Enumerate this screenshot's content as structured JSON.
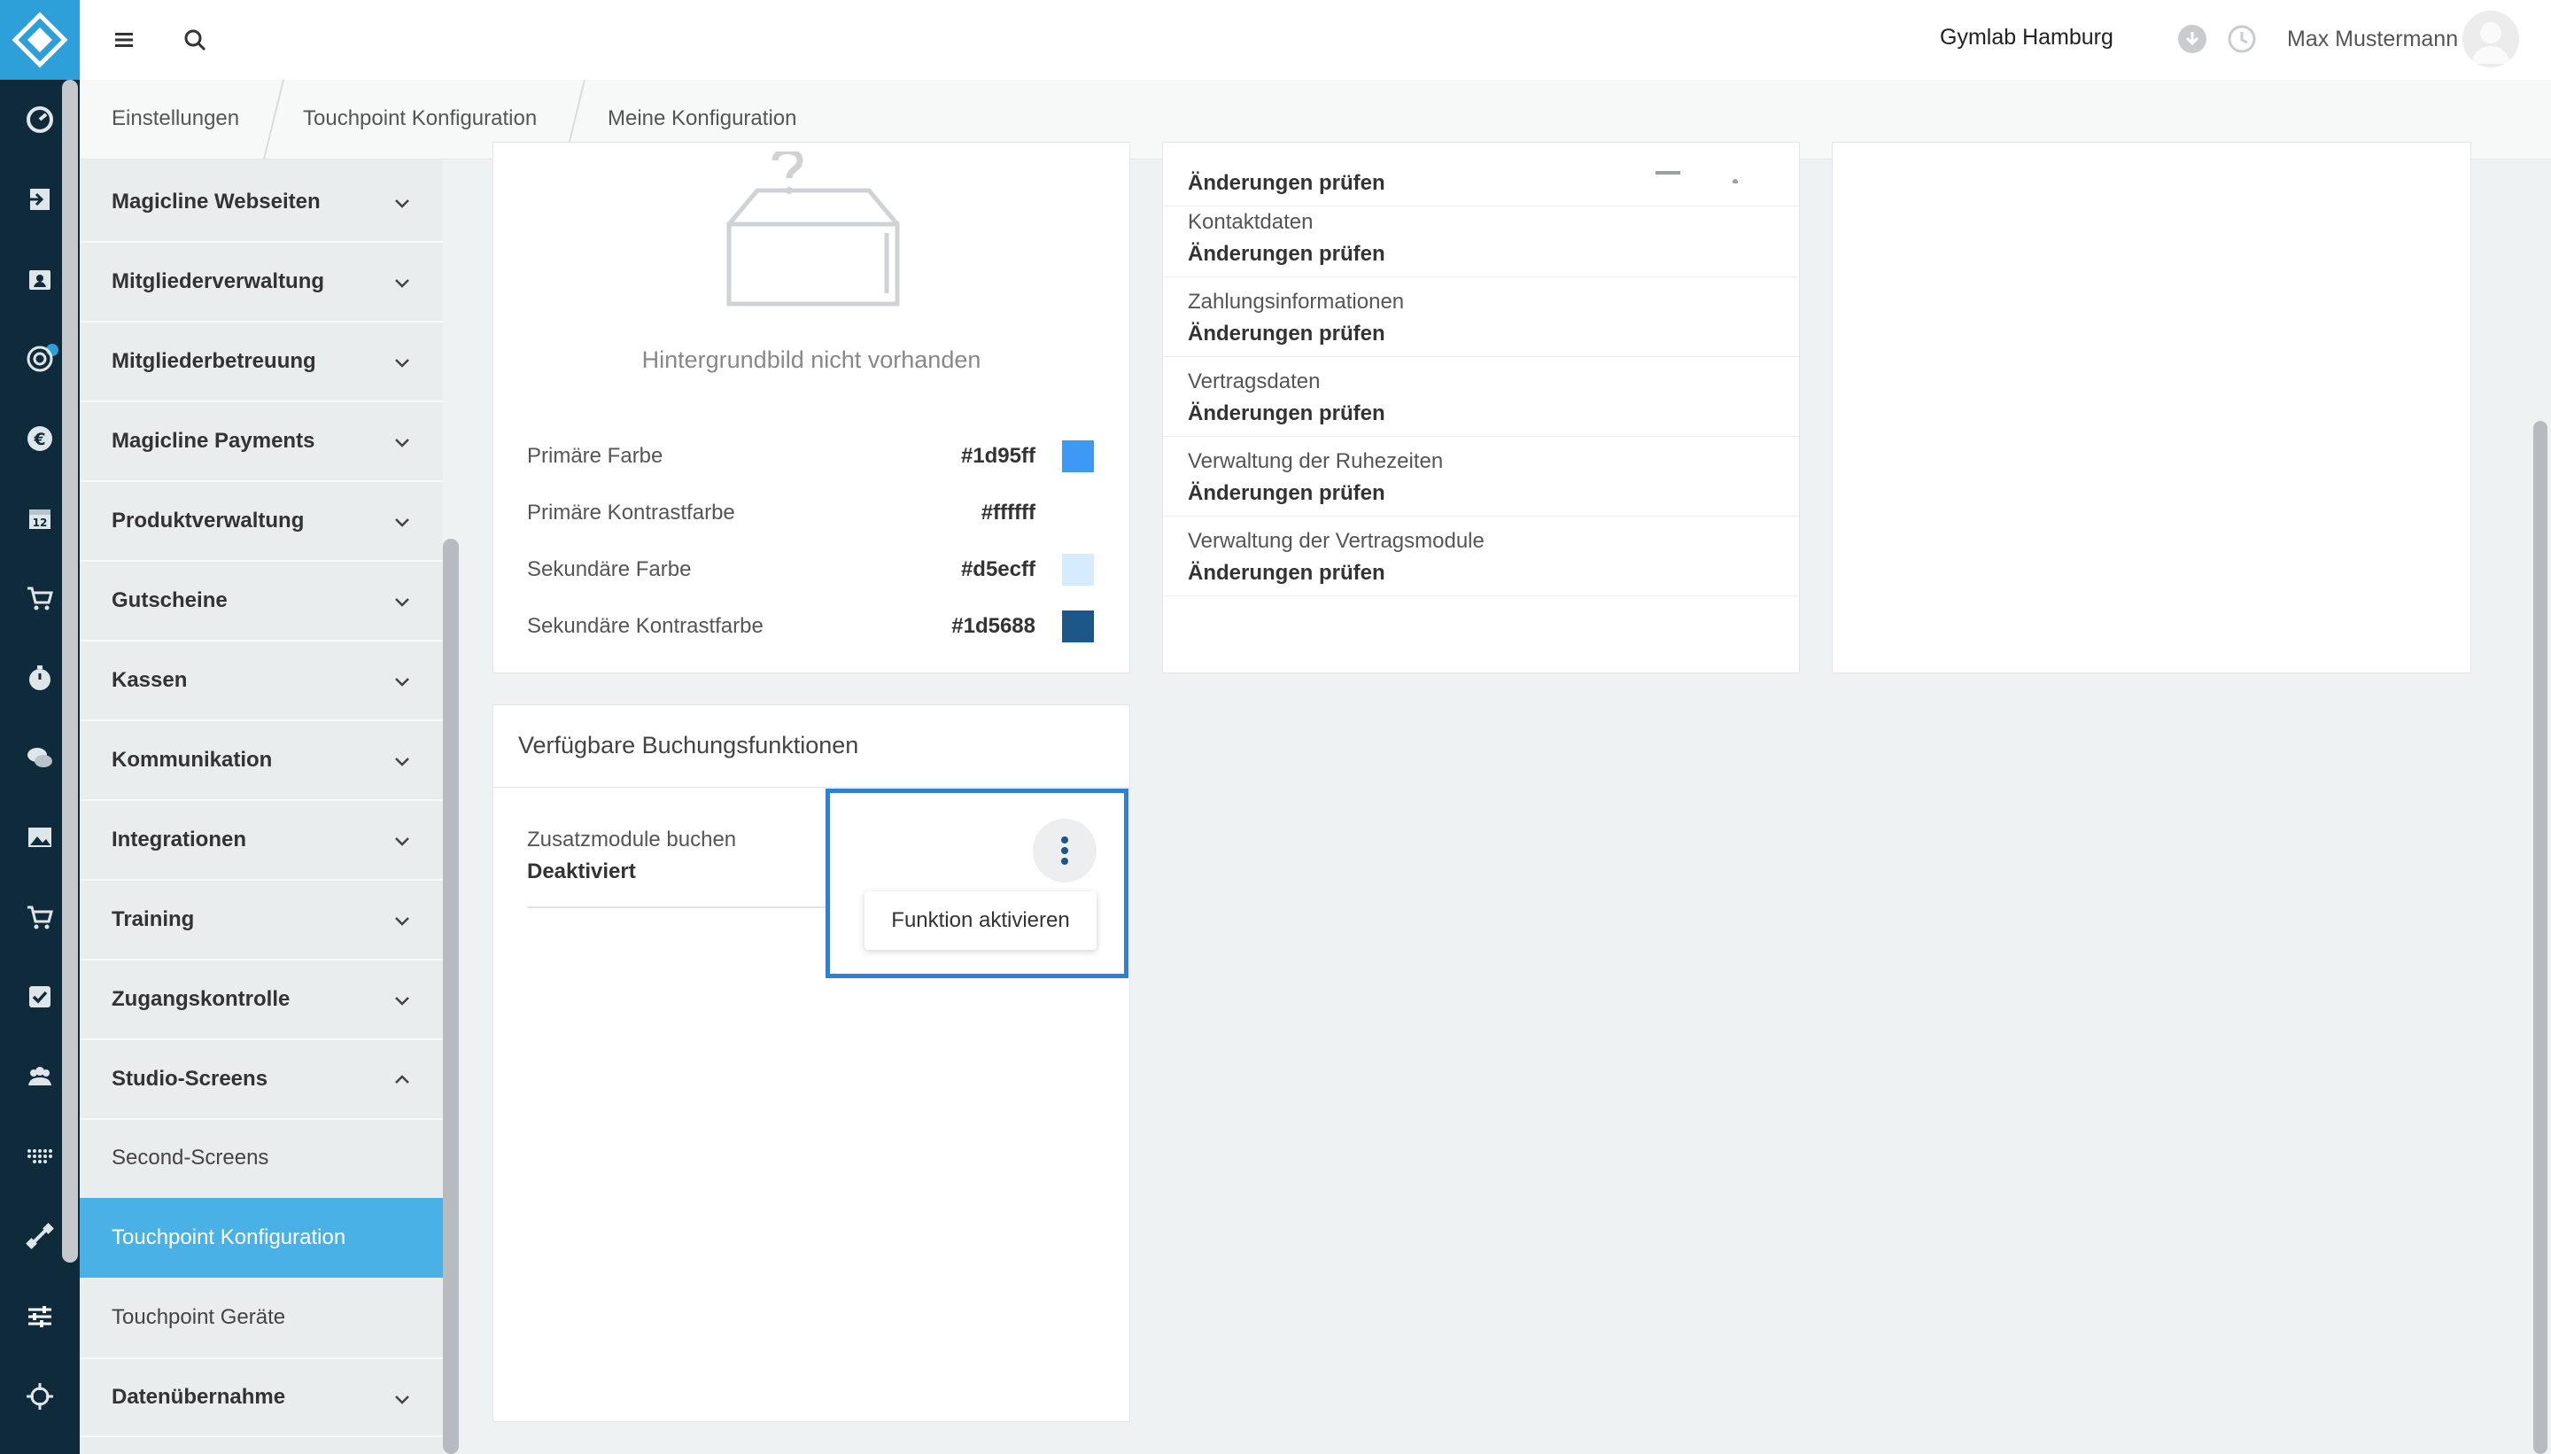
{
  "topbar": {
    "studio_name": "Gymlab Hamburg",
    "user_name": "Max Mustermann"
  },
  "breadcrumb": [
    "Einstellungen",
    "Touchpoint Konfiguration",
    "Meine Konfiguration"
  ],
  "sidebar": {
    "items": [
      {
        "label": "Magicline Webseiten"
      },
      {
        "label": "Mitgliederverwaltung"
      },
      {
        "label": "Mitgliederbetreuung"
      },
      {
        "label": "Magicline Payments"
      },
      {
        "label": "Produktverwaltung"
      },
      {
        "label": "Gutscheine"
      },
      {
        "label": "Kassen"
      },
      {
        "label": "Kommunikation"
      },
      {
        "label": "Integrationen"
      },
      {
        "label": "Training"
      },
      {
        "label": "Zugangskontrolle"
      },
      {
        "label": "Studio-Screens"
      }
    ],
    "subitems": [
      {
        "label": "Second-Screens"
      },
      {
        "label": "Touchpoint Konfiguration",
        "active": true
      },
      {
        "label": "Touchpoint Geräte"
      }
    ],
    "last_item": {
      "label": "Datenübernahme"
    }
  },
  "appearance_card": {
    "background_missing": "Hintergrundbild nicht vorhanden",
    "colors": [
      {
        "name": "Primäre Farbe",
        "hex": "#1d95ff",
        "swatch": "#3d99f5"
      },
      {
        "name": "Primäre Kontrastfarbe",
        "hex": "#ffffff",
        "swatch": "#ffffff"
      },
      {
        "name": "Sekundäre Farbe",
        "hex": "#d5ecff",
        "swatch": "#d5ecff"
      },
      {
        "name": "Sekundäre Kontrastfarbe",
        "hex": "#1d5688",
        "swatch": "#1d5688"
      }
    ]
  },
  "review_card": {
    "rows": [
      {
        "title": "",
        "status": "Änderungen prüfen"
      },
      {
        "title": "Kontaktdaten",
        "status": "Änderungen prüfen"
      },
      {
        "title": "Zahlungsinformationen",
        "status": "Änderungen prüfen"
      },
      {
        "title": "Vertragsdaten",
        "status": "Änderungen prüfen"
      },
      {
        "title": "Verwaltung der Ruhezeiten",
        "status": "Änderungen prüfen"
      },
      {
        "title": "Verwaltung der Vertragsmodule",
        "status": "Änderungen prüfen"
      }
    ]
  },
  "booking_card": {
    "title": "Verfügbare Buchungsfunktionen",
    "feature_name": "Zusatzmodule buchen",
    "feature_status": "Deaktiviert",
    "menu_action": "Funktion aktivieren"
  },
  "colors": {
    "rail_bg": "#0f2a3a",
    "brand": "#2d9fd9",
    "active_menu": "#4ab1e6",
    "highlight": "#2e7fd9"
  },
  "icons": {
    "rail": [
      "dashboard-icon",
      "login-icon",
      "contacts-icon",
      "target-icon",
      "euro-icon",
      "calendar-icon",
      "cart-icon",
      "timer-icon",
      "chat-icon",
      "image-icon",
      "cart-icon",
      "checkbox-icon",
      "group-icon",
      "dots-grid-icon",
      "dumbbell-icon",
      "sliders-icon",
      "crosshair-icon"
    ],
    "topbar": [
      "menu-icon",
      "search-icon",
      "location-pin-icon",
      "download-icon",
      "clock-icon"
    ]
  }
}
